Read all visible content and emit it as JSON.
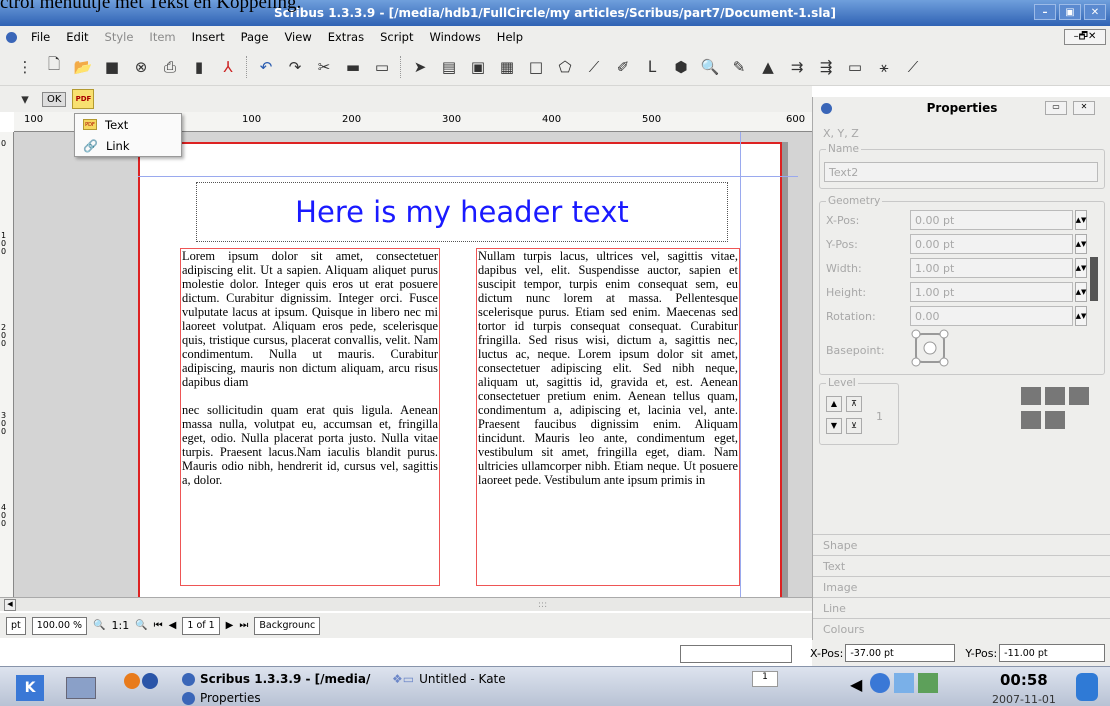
{
  "caption_text": "ctrol menuutje met Tekst en Koppeling.",
  "window": {
    "title": "Scribus 1.3.3.9 - [/media/hdb1/FullCircle/my articles/Scribus/part7/Document-1.sla]",
    "controls": [
      "–",
      "▣",
      "✕"
    ]
  },
  "menubar": {
    "items": [
      "File",
      "Edit",
      "Style",
      "Item",
      "Insert",
      "Page",
      "View",
      "Extras",
      "Script",
      "Windows",
      "Help"
    ],
    "dim_items": [
      "Style",
      "Item"
    ],
    "right_controls": "–🗗✕"
  },
  "toolbar2": {
    "ok_label": "OK",
    "pdf_label": "PDF"
  },
  "pdf_menu": {
    "items": [
      {
        "label": "Text",
        "icon": "pdf-icon"
      },
      {
        "label": "Link",
        "icon": "link-icon"
      }
    ]
  },
  "ruler": {
    "labels": [
      "100",
      "100",
      "200",
      "300",
      "400",
      "500",
      "600"
    ]
  },
  "vruler": {
    "labels": [
      "0",
      "100",
      "200",
      "300",
      "400"
    ]
  },
  "document": {
    "header_text": "Here is my header text",
    "col1_p1": "Lorem ipsum dolor sit amet, consectetuer adipiscing elit. Ut a sapien. Aliquam aliquet purus molestie dolor. Integer quis eros ut erat posuere dictum. Curabitur dignissim. Integer orci. Fusce vulputate lacus at ipsum. Quisque in libero nec mi laoreet volutpat. Aliquam eros pede, scelerisque quis, tristique cursus, placerat convallis, velit. Nam condimentum. Nulla ut mauris. Curabitur adipiscing, mauris non dictum aliquam, arcu risus dapibus diam",
    "col1_p2": "nec sollicitudin quam erat quis ligula. Aenean massa nulla, volutpat eu, accumsan et, fringilla eget, odio. Nulla placerat porta justo. Nulla vitae turpis. Praesent lacus.Nam iaculis blandit purus. Mauris odio nibh, hendrerit id, cursus vel, sagittis a, dolor.",
    "col2_p1": "Nullam turpis lacus, ultrices vel, sagittis vitae, dapibus vel, elit. Suspendisse auctor, sapien et suscipit tempor, turpis enim consequat sem, eu dictum nunc lorem at massa. Pellentesque scelerisque purus. Etiam sed enim. Maecenas sed tortor id turpis consequat consequat. Curabitur fringilla. Sed risus wisi, dictum a, sagittis nec, luctus ac, neque. Lorem ipsum dolor sit amet, consectetuer adipiscing elit. Sed nibh neque, aliquam ut, sagittis id, gravida et, est. Aenean consectetuer pretium enim. Aenean tellus quam, condimentum a, adipiscing et, lacinia vel, ante. Praesent faucibus dignissim enim. Aliquam tincidunt. Mauris leo ante, condimentum eget, vestibulum sit amet, fringilla eget, diam. Nam ultricies ullamcorper nibh. Etiam neque. Ut posuere laoreet pede. Vestibulum ante ipsum primis in"
  },
  "statusbar": {
    "unit": "pt",
    "zoom": "100.00 %",
    "zoom_ratio": "1:1",
    "page": "1 of 1",
    "layer": "Backgrounc",
    "scroll_grip": ":::"
  },
  "properties": {
    "title": "Properties",
    "tab": "X, Y, Z",
    "name_group": "Name",
    "name_value": "Text2",
    "geometry_group": "Geometry",
    "fields": [
      {
        "label": "X-Pos:",
        "value": "0.00 pt"
      },
      {
        "label": "Y-Pos:",
        "value": "0.00 pt"
      },
      {
        "label": "Width:",
        "value": "1.00 pt"
      },
      {
        "label": "Height:",
        "value": "1.00 pt"
      },
      {
        "label": "Rotation:",
        "value": "0.00"
      }
    ],
    "basepoint": "Basepoint:",
    "level_group": "Level",
    "level_value": "1",
    "sections": [
      "Shape",
      "Text",
      "Image",
      "Line",
      "Colours"
    ]
  },
  "coords": {
    "x_label": "X-Pos:",
    "x_value": "-37.00 pt",
    "y_label": "Y-Pos:",
    "y_value": "-11.00 pt"
  },
  "taskbar": {
    "task1": "Scribus 1.3.3.9 - [/media/",
    "task2": "Untitled - Kate",
    "task3": "Properties",
    "desk1": "1",
    "clock": "00:58",
    "date": "2007-11-01"
  }
}
